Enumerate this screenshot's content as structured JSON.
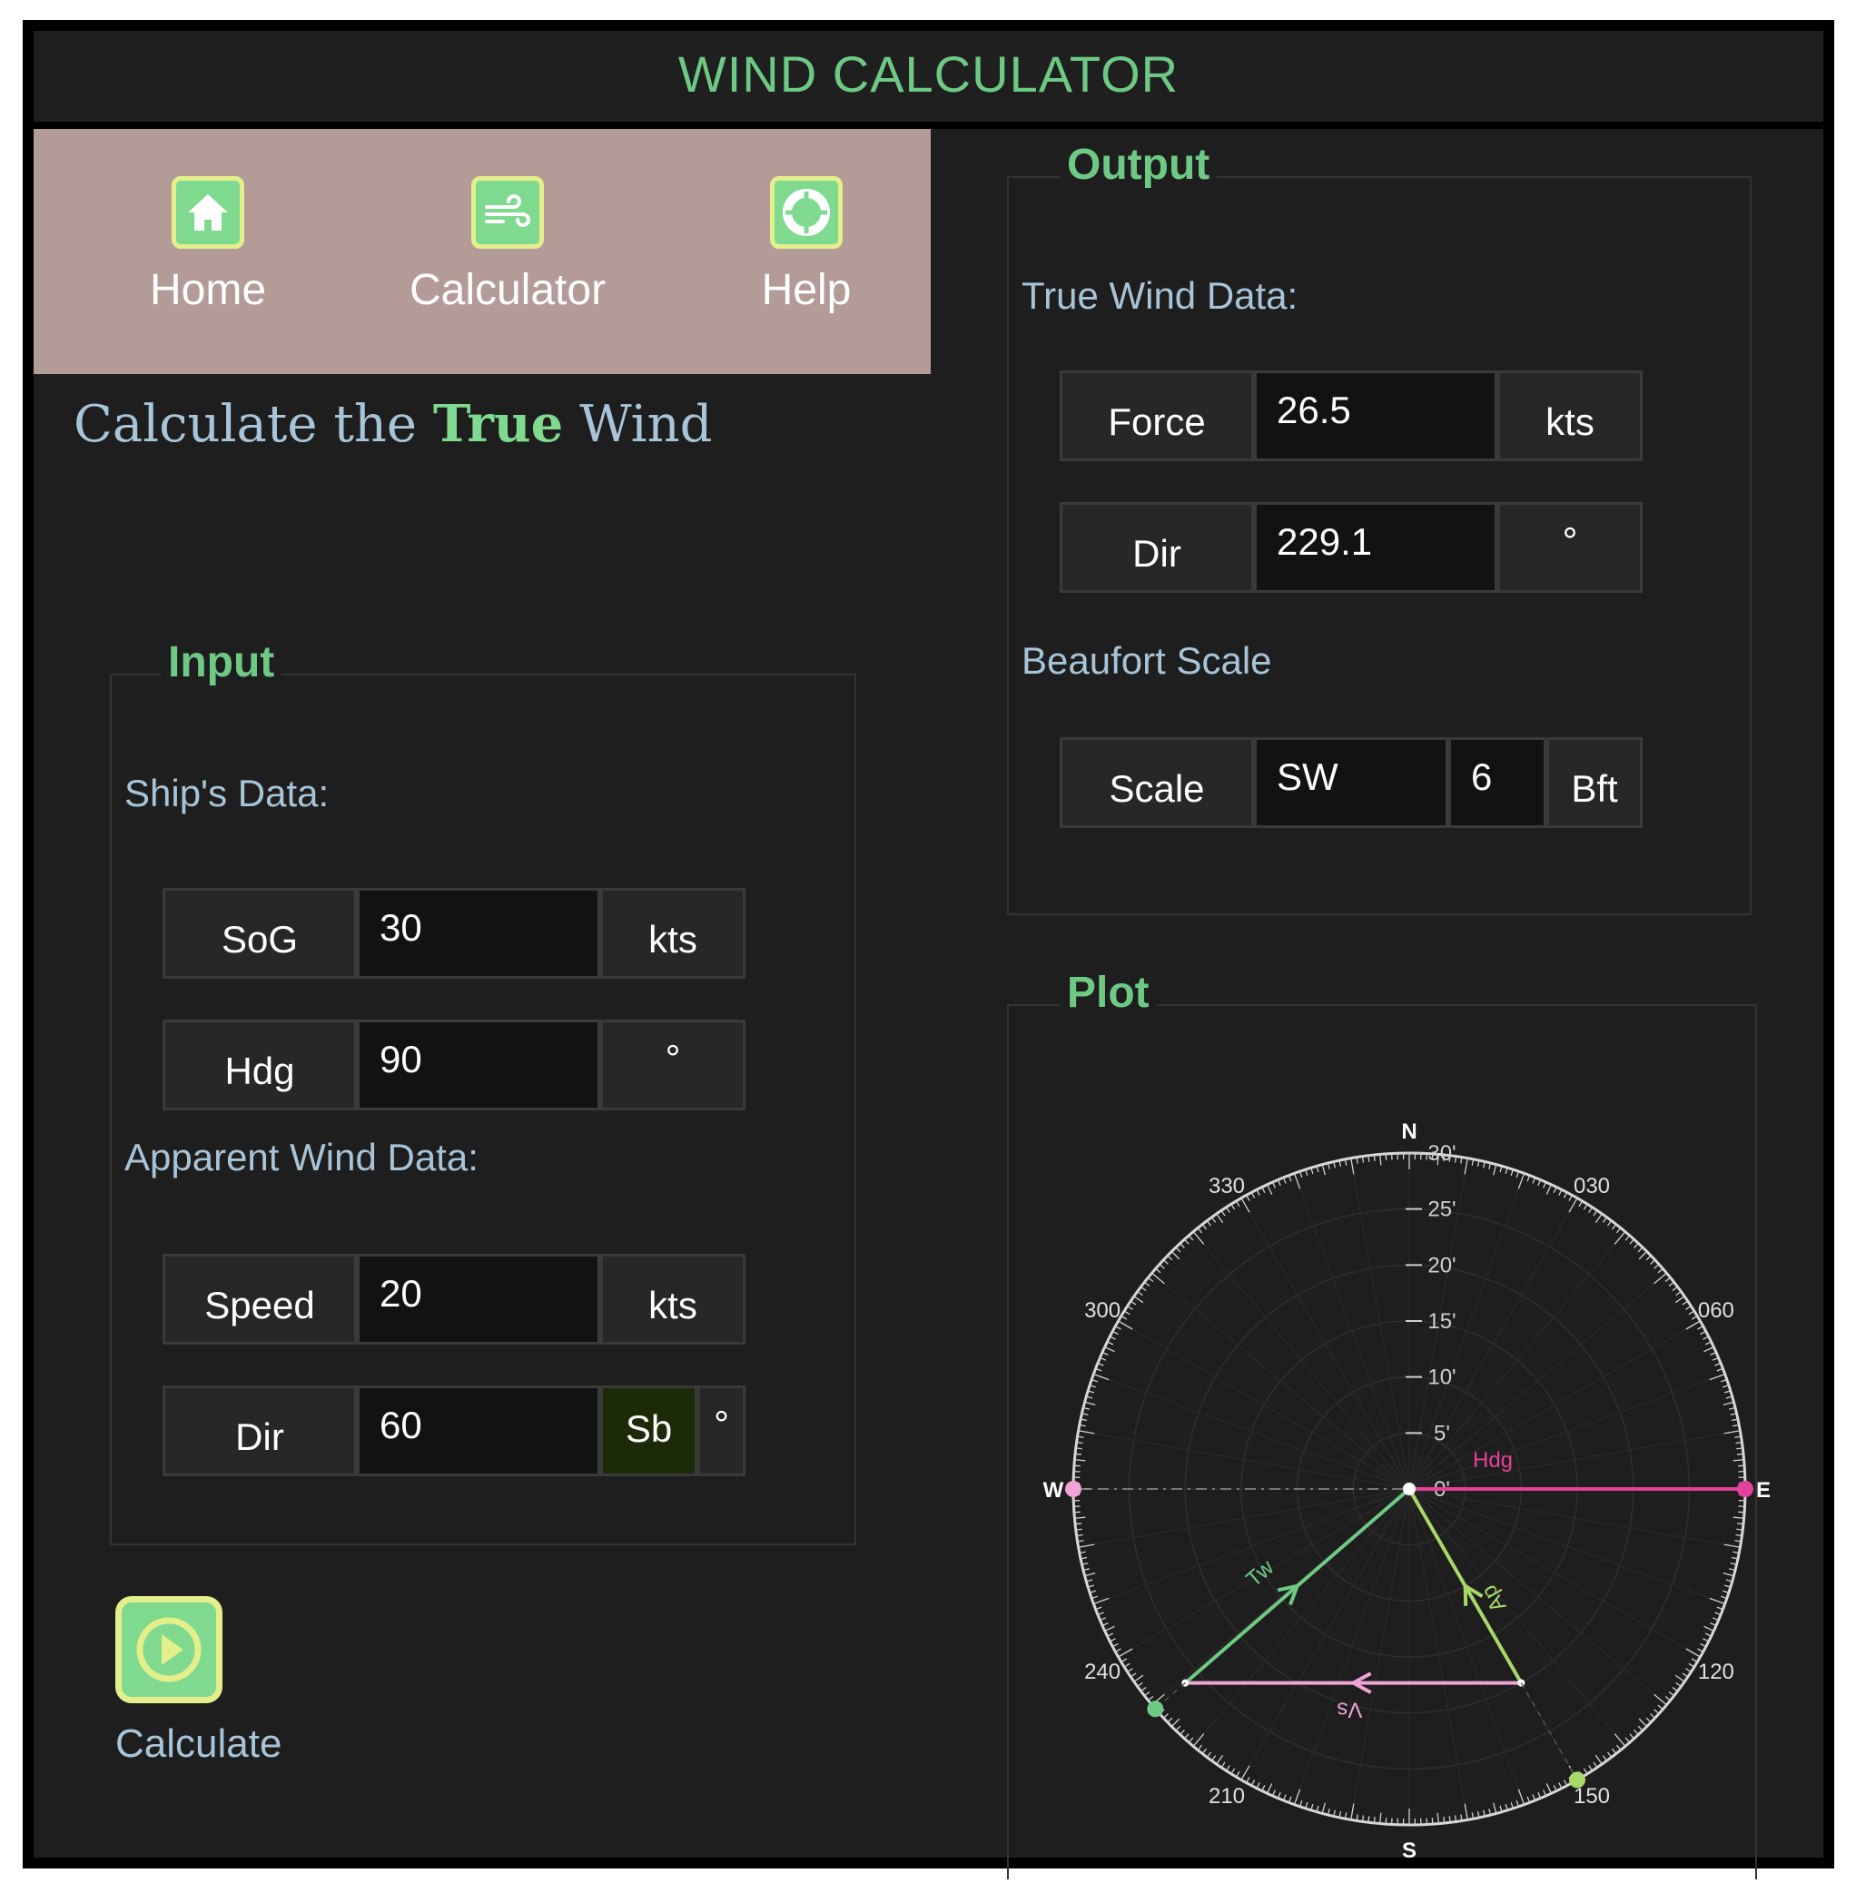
{
  "app": {
    "title": "WIND CALCULATOR"
  },
  "nav": {
    "items": [
      {
        "label": "Home",
        "icon": "home-icon"
      },
      {
        "label": "Calculator",
        "icon": "wind-icon"
      },
      {
        "label": "Help",
        "icon": "lifebuoy-icon"
      }
    ]
  },
  "main": {
    "title_pre": "Calculate the ",
    "title_hl": "True",
    "title_post": " Wind"
  },
  "input": {
    "legend": "Input",
    "ship_label": "Ship's Data:",
    "sog": {
      "label": "SoG",
      "value": "30",
      "unit": "kts"
    },
    "hdg": {
      "label": "Hdg",
      "value": "90",
      "unit": "°"
    },
    "apparent_label": "Apparent Wind Data:",
    "speed": {
      "label": "Speed",
      "value": "20",
      "unit": "kts"
    },
    "dir": {
      "label": "Dir",
      "value": "60",
      "side": "Sb",
      "unit": "°"
    }
  },
  "calculate": {
    "label": "Calculate"
  },
  "output": {
    "legend": "Output",
    "true_label": "True Wind Data:",
    "force": {
      "label": "Force",
      "value": "26.5",
      "unit": "kts"
    },
    "dir": {
      "label": "Dir",
      "value": "229.1",
      "unit": "°"
    },
    "beaufort_label": "Beaufort Scale",
    "scale": {
      "label": "Scale",
      "value": "SW",
      "number": "6",
      "unit": "Bft"
    }
  },
  "plot": {
    "legend": "Plot",
    "cardinals": {
      "n": "N",
      "e": "E",
      "s": "S",
      "w": "W"
    },
    "bearings": [
      {
        "deg": 30,
        "label": "030"
      },
      {
        "deg": 60,
        "label": "060"
      },
      {
        "deg": 120,
        "label": "120"
      },
      {
        "deg": 150,
        "label": "150"
      },
      {
        "deg": 210,
        "label": "210"
      },
      {
        "deg": 240,
        "label": "240"
      },
      {
        "deg": 300,
        "label": "300"
      },
      {
        "deg": 330,
        "label": "330"
      }
    ],
    "radial_labels": [
      "0",
      "5",
      "10",
      "15",
      "20",
      "25",
      "30"
    ],
    "radial_max": 30,
    "vectors": {
      "heading": {
        "label": "Hdg",
        "dir": 90,
        "speed": 30,
        "color": "#e5409a"
      },
      "ship": {
        "label": "Vs",
        "color": "#f0a3d4"
      },
      "apparent": {
        "label": "Ap",
        "color": "#a8d868"
      },
      "true": {
        "label": "Tw",
        "color": "#6ec985"
      }
    }
  },
  "colors": {
    "accent": "#6ec985",
    "nav_bg": "#b39c98",
    "text_blue": "#a8c4d8"
  }
}
